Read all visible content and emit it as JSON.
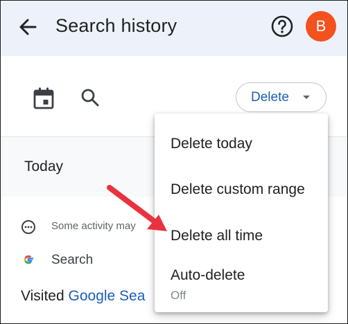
{
  "appbar": {
    "title": "Search history",
    "avatar_letter": "B",
    "avatar_color": "#f4511e",
    "background": "#edf2fa"
  },
  "toolbar": {
    "delete_label": "Delete"
  },
  "content": {
    "section_title": "Today",
    "notice_text": "Some activity may",
    "product_label": "Search",
    "visited_prefix": "Visited ",
    "visited_link": "Google Sea"
  },
  "menu": {
    "items": [
      {
        "label": "Delete today"
      },
      {
        "label": "Delete custom range"
      },
      {
        "label": "Delete all time"
      },
      {
        "label": "Auto-delete",
        "sub": "Off"
      }
    ]
  },
  "colors": {
    "accent": "#1a5fb4",
    "annotation_arrow": "#e8333f"
  },
  "icons": [
    "back-arrow-icon",
    "help-icon",
    "calendar-icon",
    "search-icon",
    "chevron-down-icon",
    "info-icon",
    "google-g-icon"
  ]
}
